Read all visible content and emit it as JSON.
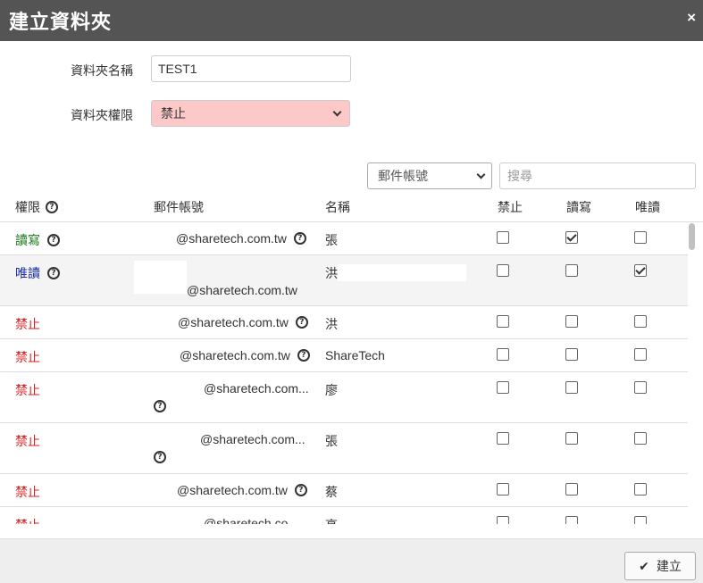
{
  "dialog": {
    "title": "建立資料夾",
    "close_glyph": "×"
  },
  "form": {
    "name_label": "資料夾名稱",
    "name_value": "TEST1",
    "perm_label": "資料夾權限",
    "perm_selected": "禁止",
    "perm_bg_color": "#fcc8c8"
  },
  "filter": {
    "field_selected": "郵件帳號",
    "search_placeholder": "搜尋"
  },
  "table": {
    "headers": {
      "perm": "權限",
      "account": "郵件帳號",
      "name": "名稱",
      "deny": "禁止",
      "rw": "讀寫",
      "ro": "唯讀"
    },
    "rows": [
      {
        "perm": "讀寫",
        "perm_type": "rw",
        "account": "@sharetech.com.tw",
        "name": "張",
        "deny": false,
        "rw": true,
        "ro": false
      },
      {
        "perm": "唯讀",
        "perm_type": "ro",
        "account": "@sharetech.com.tw",
        "name": "洪",
        "deny": false,
        "rw": false,
        "ro": true
      },
      {
        "perm": "禁止",
        "perm_type": "deny",
        "account": "@sharetech.com.tw",
        "name": "洪",
        "deny": false,
        "rw": false,
        "ro": false
      },
      {
        "perm": "禁止",
        "perm_type": "deny",
        "account": "@sharetech.com.tw",
        "name": "ShareTech",
        "deny": false,
        "rw": false,
        "ro": false
      },
      {
        "perm": "禁止",
        "perm_type": "deny",
        "account": "@sharetech.com...",
        "name": "廖",
        "deny": false,
        "rw": false,
        "ro": false
      },
      {
        "perm": "禁止",
        "perm_type": "deny",
        "account": "@sharetech.com...",
        "name": "張",
        "deny": false,
        "rw": false,
        "ro": false
      },
      {
        "perm": "禁止",
        "perm_type": "deny",
        "account": "@sharetech.com.tw",
        "name": "蔡",
        "deny": false,
        "rw": false,
        "ro": false
      },
      {
        "perm": "禁止",
        "perm_type": "deny",
        "account": "@sharetech.co",
        "name": "高",
        "deny": false,
        "rw": false,
        "ro": false
      }
    ]
  },
  "footer": {
    "create_label": "建立",
    "create_icon": "check-icon"
  }
}
